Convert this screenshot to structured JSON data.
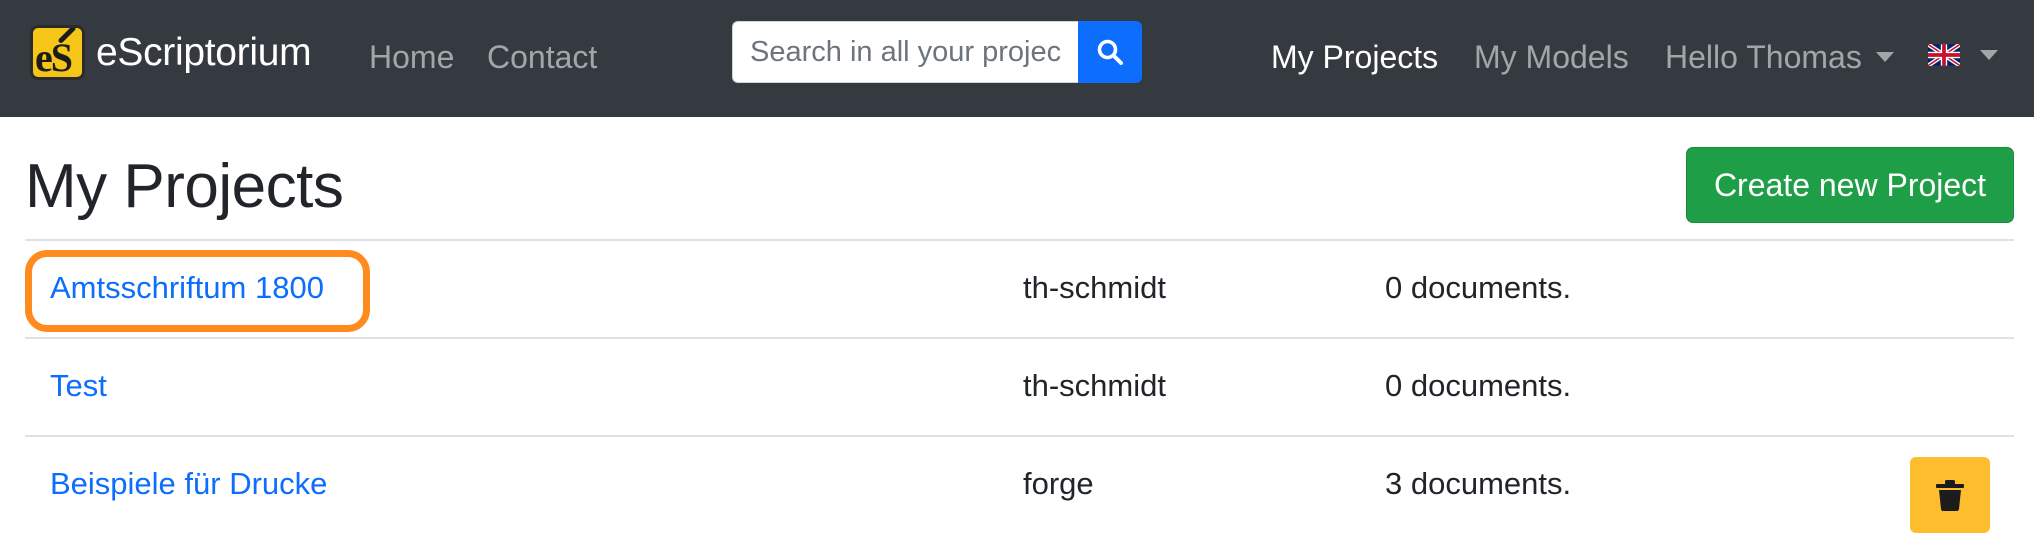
{
  "navbar": {
    "brand": "eScriptorium",
    "logo_text": "eS",
    "links": {
      "home": "Home",
      "contact": "Contact"
    },
    "search": {
      "placeholder": "Search in all your projects",
      "button_icon": "search-icon"
    },
    "right_links": {
      "my_projects": "My Projects",
      "my_models": "My Models",
      "user_menu": "Hello Thomas"
    },
    "language": {
      "icon": "uk-flag-icon"
    }
  },
  "main": {
    "title": "My Projects",
    "create_button": "Create new Project",
    "projects": [
      {
        "name": "Amtsschriftum 1800",
        "owner": "th-schmidt",
        "documents": "0 documents.",
        "highlighted": true
      },
      {
        "name": "Test",
        "owner": "th-schmidt",
        "documents": "0 documents."
      },
      {
        "name": "Beispiele für Drucke",
        "owner": "forge",
        "documents": "3 documents.",
        "delete_icon": "trash-icon"
      }
    ]
  },
  "colors": {
    "navbar_bg": "#343a40",
    "primary": "#0d6efd",
    "success": "#1e9e47",
    "warning": "#fdbd2c",
    "highlight": "#ff8a1e"
  }
}
